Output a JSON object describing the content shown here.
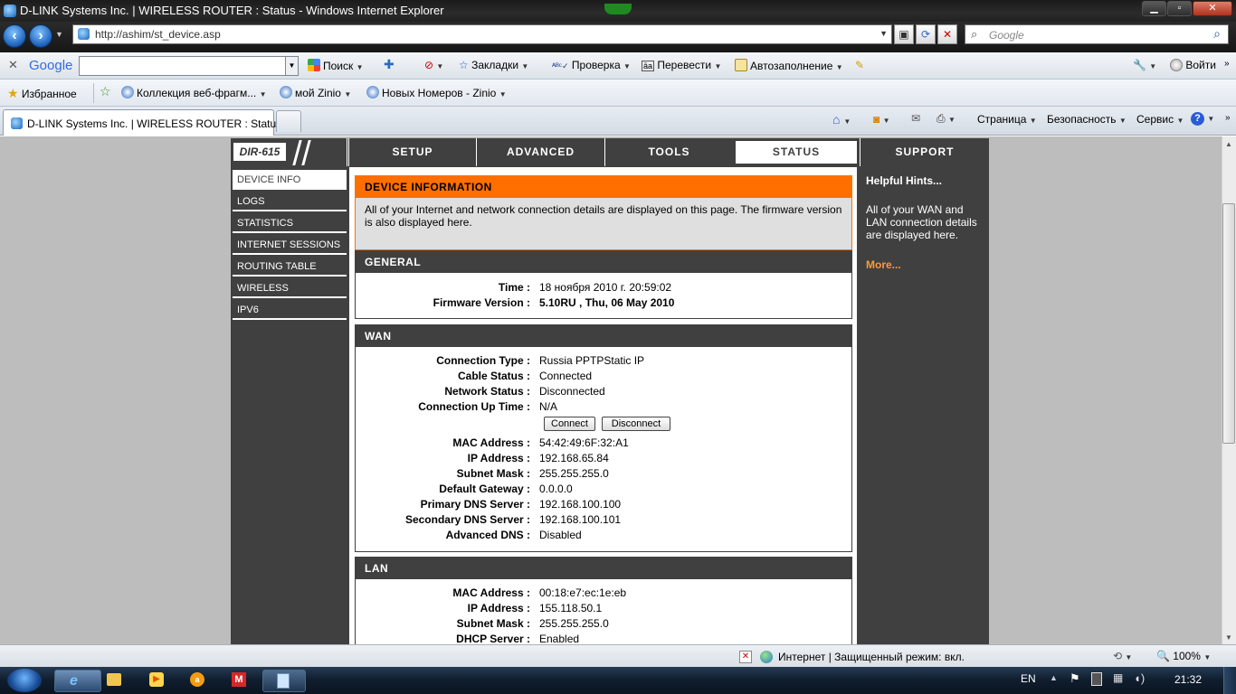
{
  "window": {
    "title": "D-LINK Systems Inc. | WIRELESS ROUTER : Status - Windows Internet Explorer",
    "min": "▁",
    "max": "▫",
    "close": "✕"
  },
  "address": {
    "url": "http://ashim/st_device.asp",
    "search_placeholder": "Google"
  },
  "google_toolbar": {
    "brand": "Google",
    "search_label": "Поиск",
    "bookmarks": "Закладки",
    "check": "Проверка",
    "translate": "Перевести",
    "autofill": "Автозаполнение",
    "signin": "Войти"
  },
  "favorites": {
    "fav": "Избранное",
    "items": [
      "Коллекция веб-фрагм...",
      "мой Zinio",
      "Новых Номеров - Zinio"
    ]
  },
  "tab": {
    "label": "D-LINK Systems Inc. | WIRELESS ROUTER : Status"
  },
  "commandbar": {
    "page": "Страница",
    "safety": "Безопасность",
    "service": "Сервис"
  },
  "router": {
    "model": "DIR-615",
    "nav": [
      "SETUP",
      "ADVANCED",
      "TOOLS",
      "STATUS",
      "SUPPORT"
    ],
    "leftnav": [
      "DEVICE INFO",
      "LOGS",
      "STATISTICS",
      "INTERNET SESSIONS",
      "ROUTING TABLE",
      "WIRELESS",
      "IPV6"
    ],
    "devinfo": {
      "title": "DEVICE INFORMATION",
      "desc": "All of your Internet and network connection details are displayed on this page. The firmware version is also displayed here."
    },
    "general": {
      "title": "GENERAL",
      "rows": [
        {
          "label": "Time :",
          "value": "18 ноября 2010 г. 20:59:02"
        },
        {
          "label": "Firmware Version :",
          "value": "5.10RU , Thu, 06 May 2010"
        }
      ]
    },
    "wan": {
      "title": "WAN",
      "rows1": [
        {
          "label": "Connection Type :",
          "value": "Russia PPTPStatic IP"
        },
        {
          "label": "Cable Status :",
          "value": "Connected"
        },
        {
          "label": "Network Status :",
          "value": "Disconnected"
        },
        {
          "label": "Connection Up Time :",
          "value": "N/A"
        }
      ],
      "connect": "Connect",
      "disconnect": "Disconnect",
      "rows2": [
        {
          "label": "MAC Address :",
          "value": "54:42:49:6F:32:A1"
        },
        {
          "label": "IP Address :",
          "value": "192.168.65.84"
        },
        {
          "label": "Subnet Mask :",
          "value": "255.255.255.0"
        },
        {
          "label": "Default Gateway :",
          "value": "0.0.0.0"
        },
        {
          "label": "Primary DNS Server :",
          "value": "192.168.100.100"
        },
        {
          "label": "Secondary DNS Server :",
          "value": "192.168.100.101"
        },
        {
          "label": "Advanced DNS :",
          "value": "Disabled"
        }
      ]
    },
    "lan": {
      "title": "LAN",
      "rows": [
        {
          "label": "MAC Address :",
          "value": "00:18:e7:ec:1e:eb"
        },
        {
          "label": "IP Address :",
          "value": "155.118.50.1"
        },
        {
          "label": "Subnet Mask :",
          "value": "255.255.255.0"
        },
        {
          "label": "DHCP Server :",
          "value": "Enabled"
        }
      ]
    },
    "hints": {
      "title": "Helpful Hints...",
      "text": "All of your WAN and LAN connection details are displayed here.",
      "more": "More..."
    }
  },
  "status": {
    "zone": "Интернет | Защищенный режим: вкл.",
    "zoom": "100%"
  },
  "taskbar": {
    "lang": "EN",
    "clock": "21:32"
  }
}
